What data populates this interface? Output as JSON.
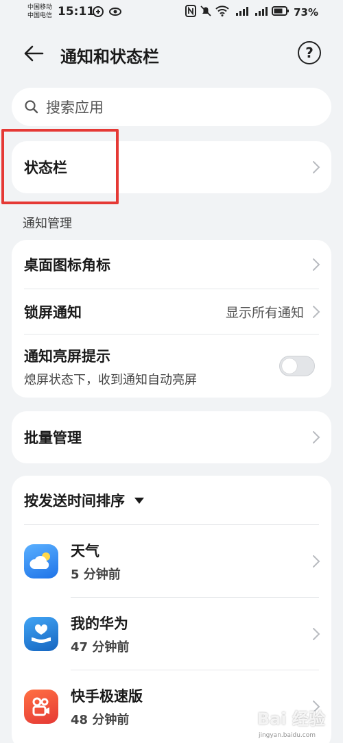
{
  "status_bar": {
    "carrier_1": "中国移动",
    "carrier_2": "中国电信",
    "time": "15:11",
    "battery": "73%"
  },
  "header": {
    "title": "通知和状态栏",
    "help_label": "?"
  },
  "search": {
    "placeholder": "搜索应用"
  },
  "status_bar_row": {
    "label": "状态栏"
  },
  "notification_section": {
    "label": "通知管理",
    "items": [
      {
        "label": "桌面图标角标"
      },
      {
        "label": "锁屏通知",
        "value": "显示所有通知"
      },
      {
        "label": "通知亮屏提示",
        "sub": "熄屏状态下，收到通知自动亮屏",
        "toggle_on": false
      }
    ]
  },
  "batch": {
    "label": "批量管理"
  },
  "app_list": {
    "sort_label": "按发送时间排序",
    "apps": [
      {
        "name": "天气",
        "time": "5 分钟前",
        "icon": "weather-icon",
        "color": "#2f8ff0"
      },
      {
        "name": "我的华为",
        "time": "47 分钟前",
        "icon": "my-huawei-icon",
        "color": "#1e88e5"
      },
      {
        "name": "快手极速版",
        "time": "48 分钟前",
        "icon": "kuaishou-icon",
        "color": "#f4511e"
      }
    ]
  },
  "watermark": {
    "text": "Bai 经验",
    "sub": "jingyan.baidu.com"
  },
  "colors": {
    "highlight": "#e53935",
    "background": "#f1f3f5"
  }
}
